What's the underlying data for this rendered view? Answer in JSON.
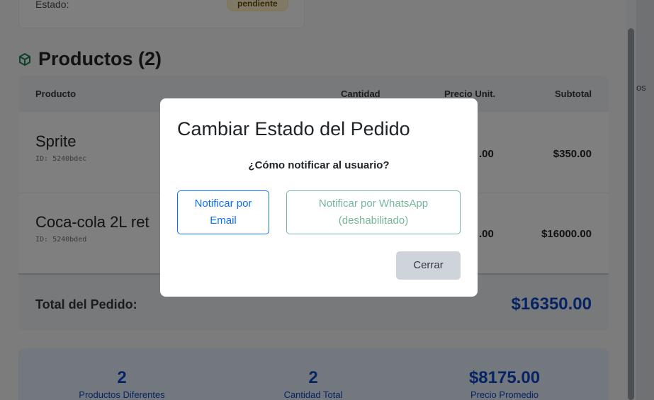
{
  "order": {
    "status_label": "Estado:",
    "status_value": "pendiente"
  },
  "products": {
    "title": "Productos (2)",
    "icon": "box-icon",
    "headers": {
      "product": "Producto",
      "quantity": "Cantidad",
      "unit_price": "Precio Unit.",
      "subtotal": "Subtotal"
    },
    "rows": [
      {
        "name": "Sprite",
        "id": "ID: 5240bdec",
        "unit_price_partial": ".00",
        "subtotal": "$350.00"
      },
      {
        "name": "Coca-cola 2L ret",
        "id": "ID: 5240bded",
        "unit_price_partial": ".00",
        "subtotal": "$16000.00"
      }
    ],
    "total_label": "Total del Pedido:",
    "total_value": "$16350.00"
  },
  "stats": [
    {
      "value": "2",
      "label": "Productos Diferentes"
    },
    {
      "value": "2",
      "label": "Cantidad Total"
    },
    {
      "value": "$8175.00",
      "label": "Precio Promedio"
    }
  ],
  "right_panel_text": "os",
  "modal": {
    "title": "Cambiar Estado del Pedido",
    "question": "¿Cómo notificar al usuario?",
    "email_button_line1": "Notificar por",
    "email_button_line2": "Email",
    "whatsapp_button_line1": "Notificar por WhatsApp",
    "whatsapp_button_line2": "(deshabilitado)",
    "close_button": "Cerrar"
  },
  "colors": {
    "primary": "#0d6efd",
    "success_disabled": "#75b798",
    "total_blue": "#0d47c9",
    "badge_bg": "#fff3cd"
  }
}
